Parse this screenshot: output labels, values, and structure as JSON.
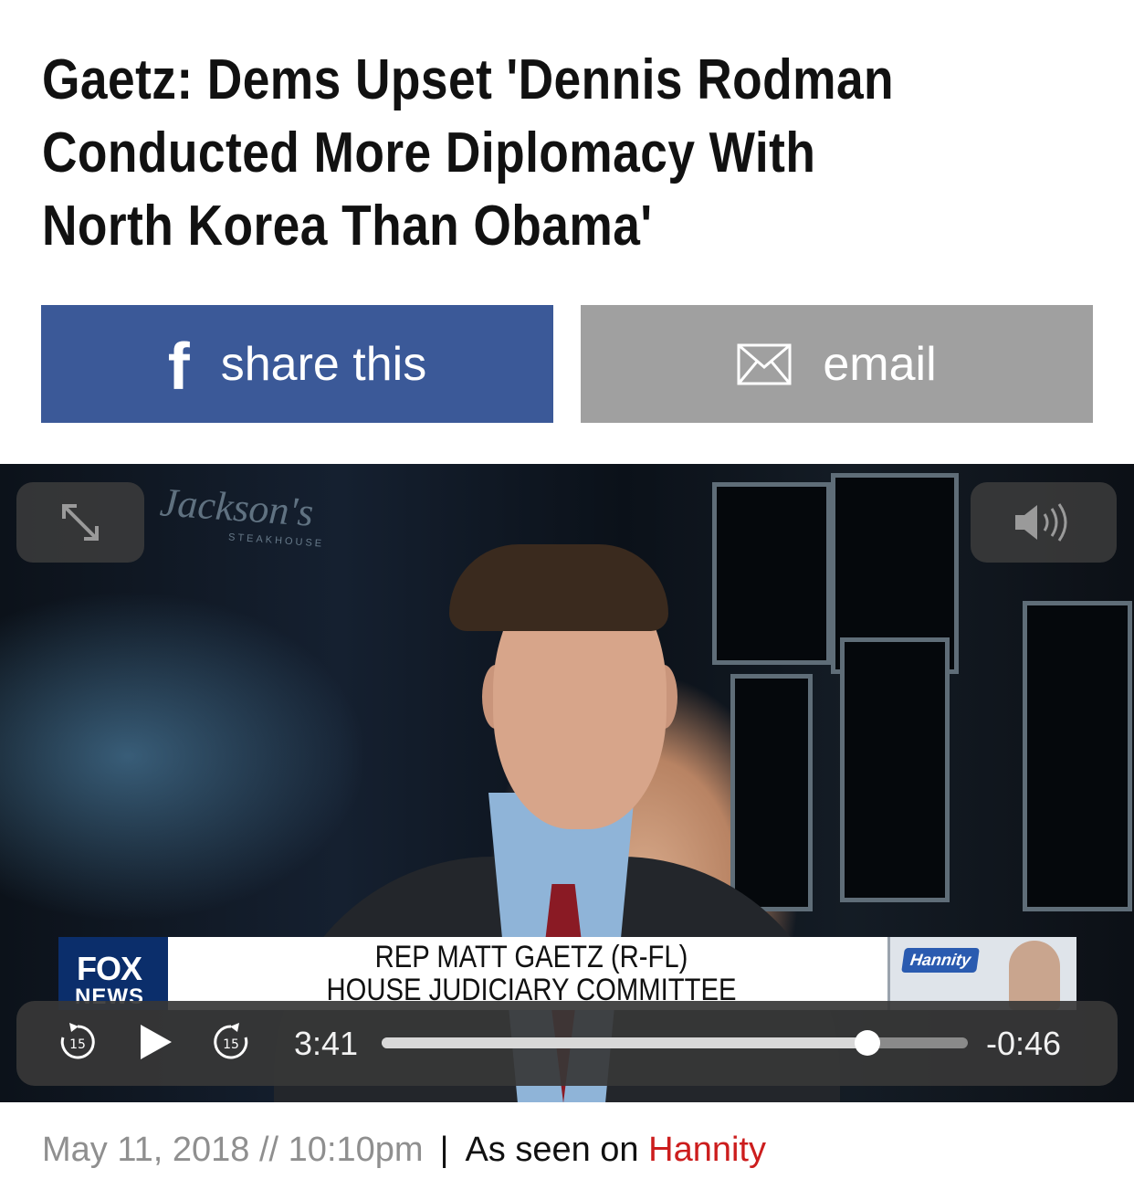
{
  "headline": {
    "lines": [
      "Gaetz: Dems Upset 'Dennis Rodman",
      "Conducted More Diplomacy With",
      "North Korea Than Obama'"
    ]
  },
  "share": {
    "facebook_label": "share this",
    "facebook_icon": "facebook-f-icon",
    "facebook_glyph": "f",
    "email_label": "email",
    "email_icon": "envelope-icon",
    "facebook_color": "#3b5998",
    "email_color": "#a0a0a0"
  },
  "video": {
    "chyron": {
      "network_top": "FOX",
      "network_bottom": "NEWS",
      "name": "REP MATT GAETZ (R-FL)",
      "title": "HOUSE JUDICIARY COMMITTEE",
      "show_logo": "Hannity"
    },
    "background_sign": "Jackson's",
    "background_sign_sub": "STEAKHOUSE",
    "controls": {
      "rewind_label": "15",
      "forward_label": "15",
      "elapsed": "3:41",
      "remaining": "-0:46",
      "progress_fraction": 0.828
    }
  },
  "meta": {
    "date": "May 11, 2018 // 10:10pm",
    "separator": "|",
    "seen_on": "As seen on",
    "show": "Hannity",
    "show_color": "#cc1d1d"
  }
}
